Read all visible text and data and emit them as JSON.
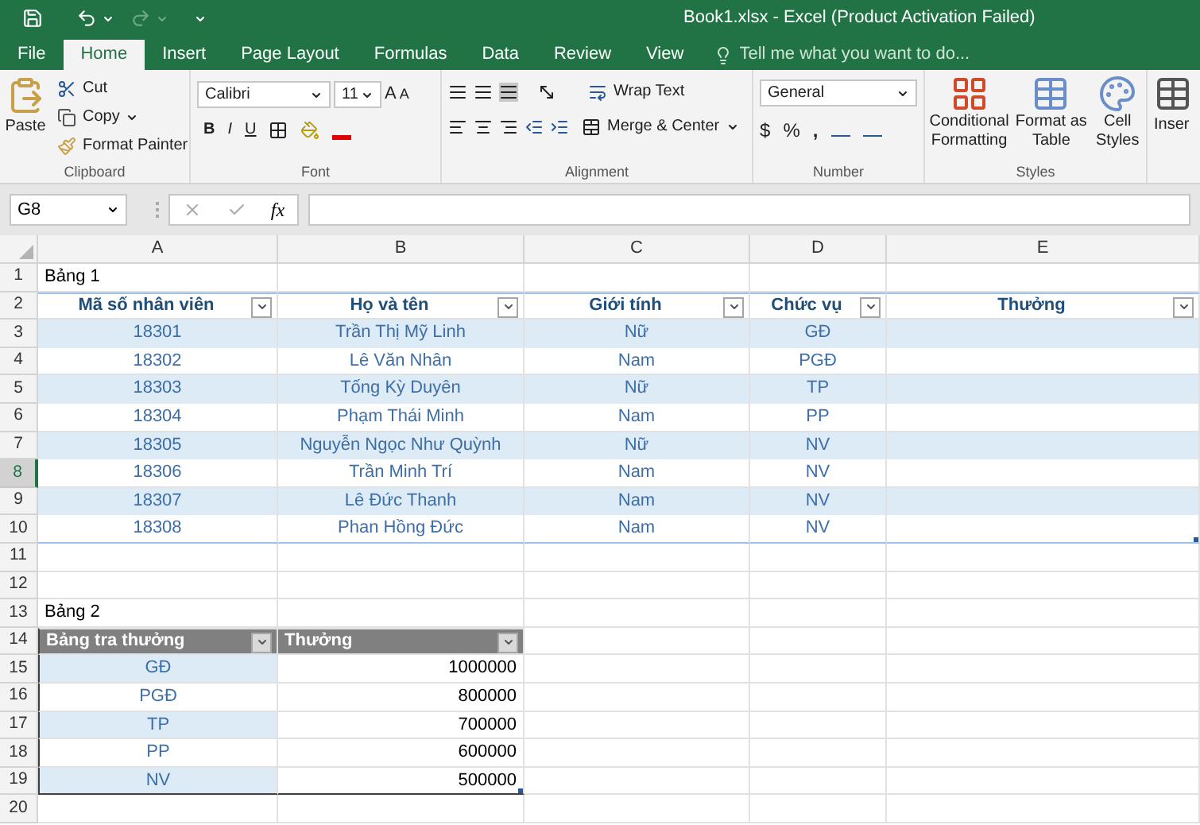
{
  "window": {
    "title": "Book1.xlsx - Excel (Product Activation Failed)"
  },
  "tabs": [
    {
      "label": "File",
      "selected": false
    },
    {
      "label": "Home",
      "selected": true
    },
    {
      "label": "Insert",
      "selected": false
    },
    {
      "label": "Page Layout",
      "selected": false
    },
    {
      "label": "Formulas",
      "selected": false
    },
    {
      "label": "Data",
      "selected": false
    },
    {
      "label": "Review",
      "selected": false
    },
    {
      "label": "View",
      "selected": false
    }
  ],
  "tell_me": {
    "placeholder": "Tell me what you want to do..."
  },
  "ribbon": {
    "clipboard": {
      "paste": "Paste",
      "cut": "Cut",
      "copy": "Copy",
      "format_painter": "Format Painter",
      "label": "Clipboard"
    },
    "font": {
      "name": "Calibri",
      "size": "11",
      "grow": "A",
      "shrink": "A",
      "bold": "B",
      "italic": "I",
      "underline": "U",
      "label": "Font"
    },
    "alignment": {
      "wrap_text": "Wrap Text",
      "merge": "Merge & Center",
      "label": "Alignment"
    },
    "number": {
      "format": "General",
      "currency": "$",
      "percent": "%",
      "comma": ",",
      "label": "Number"
    },
    "styles": {
      "buttons": [
        "Conditional Formatting",
        "Format as Table",
        "Cell Styles"
      ],
      "label": "Styles"
    },
    "insert": "Inser"
  },
  "formula_bar": {
    "name_box": "G8",
    "fx": "fx"
  },
  "sheet": {
    "columns": [
      "A",
      "B",
      "C",
      "D",
      "E"
    ],
    "rows": [
      {
        "number": "1",
        "selected": false,
        "kind": "text",
        "cells": [
          "Bảng 1"
        ]
      },
      {
        "number": "2",
        "selected": false,
        "kind": "t1-header",
        "cells": [
          "Mã số nhân viên",
          "Họ và tên",
          "Giới tính",
          "Chức vụ",
          "Thưởng"
        ]
      },
      {
        "number": "3",
        "selected": false,
        "kind": "t1-row",
        "banded": true,
        "cells": [
          "18301",
          "Trần Thị Mỹ Linh",
          "Nữ",
          "GĐ"
        ]
      },
      {
        "number": "4",
        "selected": false,
        "kind": "t1-row",
        "banded": false,
        "cells": [
          "18302",
          "Lê Văn Nhân",
          "Nam",
          "PGĐ"
        ]
      },
      {
        "number": "5",
        "selected": false,
        "kind": "t1-row",
        "banded": true,
        "cells": [
          "18303",
          "Tống Kỳ Duyên",
          "Nữ",
          "TP"
        ]
      },
      {
        "number": "6",
        "selected": false,
        "kind": "t1-row",
        "banded": false,
        "cells": [
          "18304",
          "Phạm Thái Minh",
          "Nam",
          "PP"
        ]
      },
      {
        "number": "7",
        "selected": false,
        "kind": "t1-row",
        "banded": true,
        "cells": [
          "18305",
          "Nguyễn Ngọc Như Quỳnh",
          "Nữ",
          "NV"
        ]
      },
      {
        "number": "8",
        "selected": true,
        "kind": "t1-row",
        "banded": false,
        "cells": [
          "18306",
          "Trần Minh Trí",
          "Nam",
          "NV"
        ]
      },
      {
        "number": "9",
        "selected": false,
        "kind": "t1-row",
        "banded": true,
        "cells": [
          "18307",
          "Lê Đức Thanh",
          "Nam",
          "NV"
        ]
      },
      {
        "number": "10",
        "selected": false,
        "kind": "t1-row",
        "banded": false,
        "cells": [
          "18308",
          "Phan Hồng Đức",
          "Nam",
          "NV"
        ]
      },
      {
        "number": "11",
        "selected": false,
        "kind": "blank"
      },
      {
        "number": "12",
        "selected": false,
        "kind": "blank"
      },
      {
        "number": "13",
        "selected": false,
        "kind": "text",
        "cells": [
          "Bảng 2"
        ]
      },
      {
        "number": "14",
        "selected": false,
        "kind": "t2-header",
        "cells": [
          "Bảng tra thưởng",
          "Thưởng"
        ]
      },
      {
        "number": "15",
        "selected": false,
        "kind": "t2-row",
        "banded": true,
        "cells": [
          "GĐ",
          "1000000"
        ]
      },
      {
        "number": "16",
        "selected": false,
        "kind": "t2-row",
        "banded": false,
        "cells": [
          "PGĐ",
          "800000"
        ]
      },
      {
        "number": "17",
        "selected": false,
        "kind": "t2-row",
        "banded": true,
        "cells": [
          "TP",
          "700000"
        ]
      },
      {
        "number": "18",
        "selected": false,
        "kind": "t2-row",
        "banded": false,
        "cells": [
          "PP",
          "600000"
        ]
      },
      {
        "number": "19",
        "selected": false,
        "kind": "t2-row",
        "banded": true,
        "cells": [
          "NV",
          "500000"
        ]
      },
      {
        "number": "20",
        "selected": false,
        "kind": "blank"
      }
    ]
  }
}
